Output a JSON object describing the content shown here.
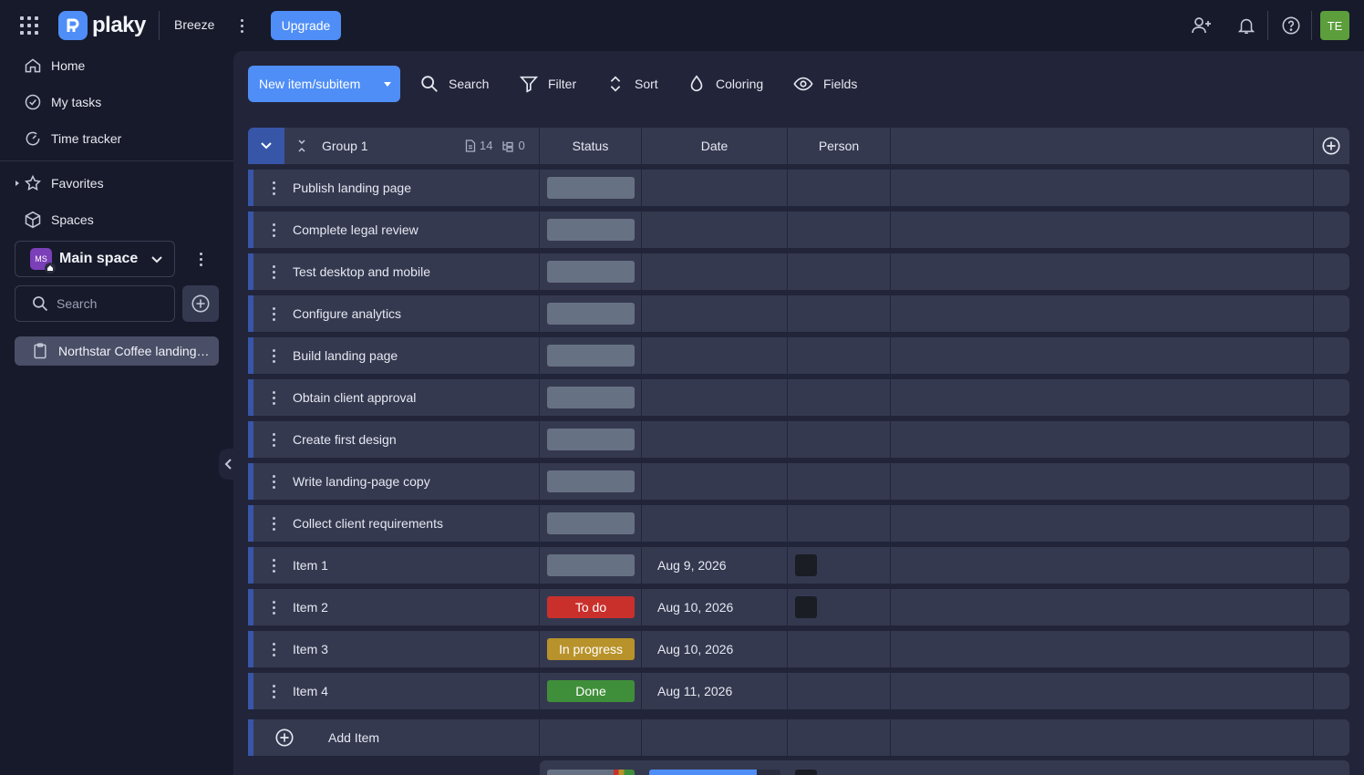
{
  "topbar": {
    "logo_text": "plaky",
    "workspace": "Breeze",
    "upgrade_label": "Upgrade",
    "avatar_initials": "TE",
    "icons": [
      "apps-grid-icon",
      "invite-user-icon",
      "bell-icon",
      "help-icon"
    ]
  },
  "sidebar": {
    "items": [
      {
        "label": "Home",
        "icon": "home-icon"
      },
      {
        "label": "My tasks",
        "icon": "check-circle-icon"
      },
      {
        "label": "Time tracker",
        "icon": "timer-icon"
      },
      {
        "label": "Favorites",
        "icon": "star-icon"
      },
      {
        "label": "Spaces",
        "icon": "cube-icon"
      }
    ],
    "space": {
      "badge": "MS",
      "name": "Main space",
      "color": "#7b3fb8"
    },
    "search_placeholder": "Search",
    "board": {
      "label": "Northstar Coffee landing page"
    }
  },
  "toolbar": {
    "new_item_label": "New item/subitem",
    "search_label": "Search",
    "filter_label": "Filter",
    "sort_label": "Sort",
    "coloring_label": "Coloring",
    "fields_label": "Fields"
  },
  "table": {
    "group_name": "Group 1",
    "item_count": "14",
    "subitem_count": "0",
    "columns": {
      "status": "Status",
      "date": "Date",
      "person": "Person"
    },
    "rows": [
      {
        "name": "Publish landing page",
        "status": "",
        "status_color": "#677184",
        "date": "",
        "person": false
      },
      {
        "name": "Complete legal review",
        "status": "",
        "status_color": "#677184",
        "date": "",
        "person": false
      },
      {
        "name": "Test desktop and mobile",
        "status": "",
        "status_color": "#677184",
        "date": "",
        "person": false
      },
      {
        "name": "Configure analytics",
        "status": "",
        "status_color": "#677184",
        "date": "",
        "person": false
      },
      {
        "name": "Build landing page",
        "status": "",
        "status_color": "#677184",
        "date": "",
        "person": false
      },
      {
        "name": "Obtain client approval",
        "status": "",
        "status_color": "#677184",
        "date": "",
        "person": false
      },
      {
        "name": "Create first design",
        "status": "",
        "status_color": "#677184",
        "date": "",
        "person": false
      },
      {
        "name": "Write landing-page copy",
        "status": "",
        "status_color": "#677184",
        "date": "",
        "person": false
      },
      {
        "name": "Collect client requirements",
        "status": "",
        "status_color": "#677184",
        "date": "",
        "person": false
      },
      {
        "name": "Item 1",
        "status": "",
        "status_color": "#677184",
        "date": "Aug 9, 2026",
        "person": true
      },
      {
        "name": "Item 2",
        "status": "To do",
        "status_color": "#c9302c",
        "date": "Aug 10, 2026",
        "person": true
      },
      {
        "name": "Item 3",
        "status": "In progress",
        "status_color": "#b8922a",
        "date": "Aug 10, 2026",
        "person": false
      },
      {
        "name": "Item 4",
        "status": "Done",
        "status_color": "#3f8f3a",
        "date": "Aug 11, 2026",
        "person": false
      }
    ],
    "add_item_label": "Add Item"
  },
  "colors": {
    "accent": "#4f8ef7",
    "group": "#3756a8",
    "background": "#171a2a"
  }
}
